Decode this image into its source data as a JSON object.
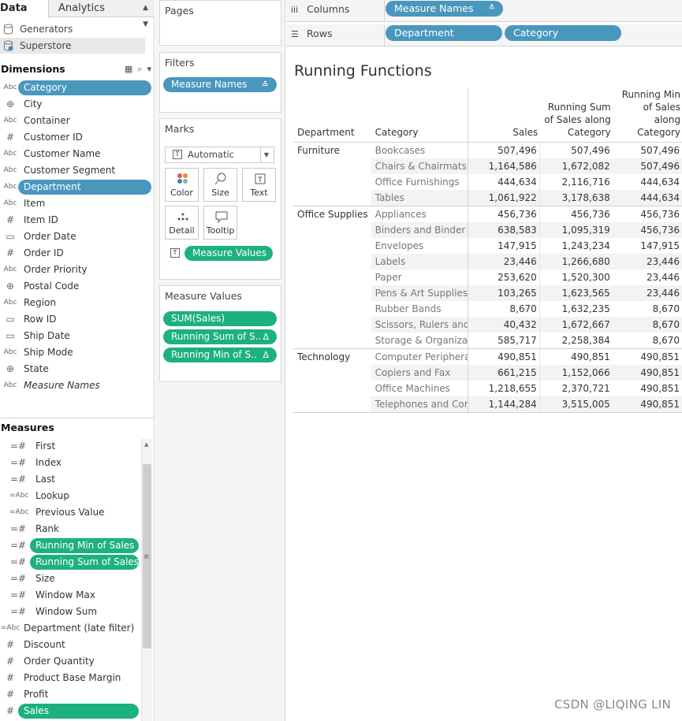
{
  "tabs": {
    "data": "Data",
    "analytics": "Analytics"
  },
  "datasources": [
    "Generators",
    "Superstore"
  ],
  "dimensions": {
    "title": "Dimensions",
    "fields": [
      {
        "type": "Abc",
        "name": "Category"
      },
      {
        "type": "globe",
        "name": "City"
      },
      {
        "type": "Abc",
        "name": "Container"
      },
      {
        "type": "#",
        "name": "Customer ID"
      },
      {
        "type": "Abc",
        "name": "Customer Name"
      },
      {
        "type": "Abc",
        "name": "Customer Segment"
      },
      {
        "type": "Abc",
        "name": "Department"
      },
      {
        "type": "Abc",
        "name": "Item"
      },
      {
        "type": "#",
        "name": "Item ID"
      },
      {
        "type": "calendar",
        "name": "Order Date"
      },
      {
        "type": "#",
        "name": "Order ID"
      },
      {
        "type": "Abc",
        "name": "Order Priority"
      },
      {
        "type": "globe",
        "name": "Postal Code"
      },
      {
        "type": "Abc",
        "name": "Region"
      },
      {
        "type": "calendar",
        "name": "Row ID"
      },
      {
        "type": "calendar",
        "name": "Ship Date"
      },
      {
        "type": "Abc",
        "name": "Ship Mode"
      },
      {
        "type": "globe",
        "name": "State"
      },
      {
        "type": "Abc",
        "name": "Measure Names"
      }
    ]
  },
  "measures": {
    "title": "Measures",
    "fields": [
      {
        "type": "=#",
        "name": "First"
      },
      {
        "type": "=#",
        "name": "Index"
      },
      {
        "type": "=#",
        "name": "Last"
      },
      {
        "type": "=Abc",
        "name": "Lookup"
      },
      {
        "type": "=Abc",
        "name": "Previous Value"
      },
      {
        "type": "=#",
        "name": "Rank"
      },
      {
        "type": "=#",
        "name": "Running Min of Sales"
      },
      {
        "type": "=#",
        "name": "Running Sum of Sales"
      },
      {
        "type": "=#",
        "name": "Size"
      },
      {
        "type": "=#",
        "name": "Window Max"
      },
      {
        "type": "=#",
        "name": "Window Sum"
      },
      {
        "type": "=Abc",
        "name": "Department (late filter)"
      },
      {
        "type": "#",
        "name": "Discount"
      },
      {
        "type": "#",
        "name": "Order Quantity"
      },
      {
        "type": "#",
        "name": "Product Base Margin"
      },
      {
        "type": "#",
        "name": "Profit"
      },
      {
        "type": "#",
        "name": "Sales"
      }
    ]
  },
  "cards": {
    "pages": "Pages",
    "filters": "Filters",
    "filter_pill": "Measure Names",
    "marks": "Marks",
    "mark_type": "Automatic",
    "mark_buttons": [
      "Color",
      "Size",
      "Text",
      "Detail",
      "Tooltip"
    ],
    "marks_pill": "Measure Values",
    "measure_values_title": "Measure Values",
    "measure_values": [
      "SUM(Sales)",
      "Running Sum of S..",
      "Running Min of S.."
    ],
    "delta": "Δ"
  },
  "shelves": {
    "columns": "Columns",
    "rows": "Rows",
    "columns_pill": "Measure Names",
    "rows_pills": [
      "Department",
      "Category"
    ]
  },
  "view": {
    "title": "Running Functions",
    "headers": [
      "Department",
      "Category",
      "Sales",
      "Running Sum of Sales along Category",
      "Running Min of Sales along Category"
    ],
    "rows": [
      {
        "dept": "Furniture",
        "cat": "Bookcases",
        "sales": "507,496",
        "rsum": "507,496",
        "rmin": "507,496"
      },
      {
        "dept": "",
        "cat": "Chairs & Chairmats",
        "sales": "1,164,586",
        "rsum": "1,672,082",
        "rmin": "507,496"
      },
      {
        "dept": "",
        "cat": "Office Furnishings",
        "sales": "444,634",
        "rsum": "2,116,716",
        "rmin": "444,634"
      },
      {
        "dept": "",
        "cat": "Tables",
        "sales": "1,061,922",
        "rsum": "3,178,638",
        "rmin": "444,634"
      },
      {
        "dept": "Office Supplies",
        "cat": "Appliances",
        "sales": "456,736",
        "rsum": "456,736",
        "rmin": "456,736"
      },
      {
        "dept": "",
        "cat": "Binders and Binder ..",
        "sales": "638,583",
        "rsum": "1,095,319",
        "rmin": "456,736"
      },
      {
        "dept": "",
        "cat": "Envelopes",
        "sales": "147,915",
        "rsum": "1,243,234",
        "rmin": "147,915"
      },
      {
        "dept": "",
        "cat": "Labels",
        "sales": "23,446",
        "rsum": "1,266,680",
        "rmin": "23,446"
      },
      {
        "dept": "",
        "cat": "Paper",
        "sales": "253,620",
        "rsum": "1,520,300",
        "rmin": "23,446"
      },
      {
        "dept": "",
        "cat": "Pens & Art Supplies",
        "sales": "103,265",
        "rsum": "1,623,565",
        "rmin": "23,446"
      },
      {
        "dept": "",
        "cat": "Rubber Bands",
        "sales": "8,670",
        "rsum": "1,632,235",
        "rmin": "8,670"
      },
      {
        "dept": "",
        "cat": "Scissors, Rulers and ..",
        "sales": "40,432",
        "rsum": "1,672,667",
        "rmin": "8,670"
      },
      {
        "dept": "",
        "cat": "Storage & Organizat..",
        "sales": "585,717",
        "rsum": "2,258,384",
        "rmin": "8,670"
      },
      {
        "dept": "Technology",
        "cat": "Computer Periphera..",
        "sales": "490,851",
        "rsum": "490,851",
        "rmin": "490,851"
      },
      {
        "dept": "",
        "cat": "Copiers and Fax",
        "sales": "661,215",
        "rsum": "1,152,066",
        "rmin": "490,851"
      },
      {
        "dept": "",
        "cat": "Office Machines",
        "sales": "1,218,655",
        "rsum": "2,370,721",
        "rmin": "490,851"
      },
      {
        "dept": "",
        "cat": "Telephones and Com..",
        "sales": "1,144,284",
        "rsum": "3,515,005",
        "rmin": "490,851"
      }
    ]
  },
  "watermark": "CSDN @LIQING LIN",
  "colors": {
    "blue_pill": "#4a97bd",
    "green_pill": "#1db17d"
  }
}
